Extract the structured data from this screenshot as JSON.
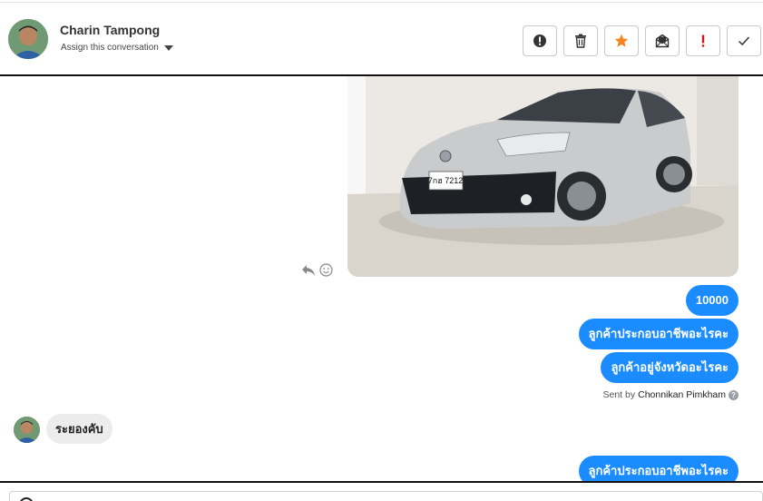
{
  "contact": {
    "name": "Charin Tampong",
    "assign_label": "Assign this conversation"
  },
  "toolbar": {
    "buttons": [
      {
        "icon": "exclamation-circle-icon",
        "color": "#333333"
      },
      {
        "icon": "trash-icon",
        "color": "#333333"
      },
      {
        "icon": "star-icon",
        "color": "#f5831f"
      },
      {
        "icon": "envelope-open-icon",
        "color": "#333333"
      },
      {
        "icon": "exclamation-mark-icon",
        "color": "#d11a1a"
      },
      {
        "icon": "checkmark-icon",
        "color": "#333333"
      }
    ]
  },
  "messages": {
    "outgoing": [
      {
        "text": "10000"
      },
      {
        "text": "ลูกค้าประกอบอาชีพอะไรคะ"
      },
      {
        "text": "ลูกค้าอยู่จังหวัดอะไรคะ"
      },
      {
        "text": "ลูกค้าประกอบอาชีพอะไรคะ"
      }
    ],
    "sent_by_prefix": "Sent by",
    "sent_by_agent": "Chonnikan Pimkham",
    "incoming": [
      {
        "text": "ระยองคับ"
      }
    ],
    "photo_plate_text": "7กฮ 7212"
  },
  "colors": {
    "accent": "#1a8cff",
    "incoming_bubble": "#ececec",
    "star": "#f5831f",
    "alert": "#d11a1a"
  }
}
